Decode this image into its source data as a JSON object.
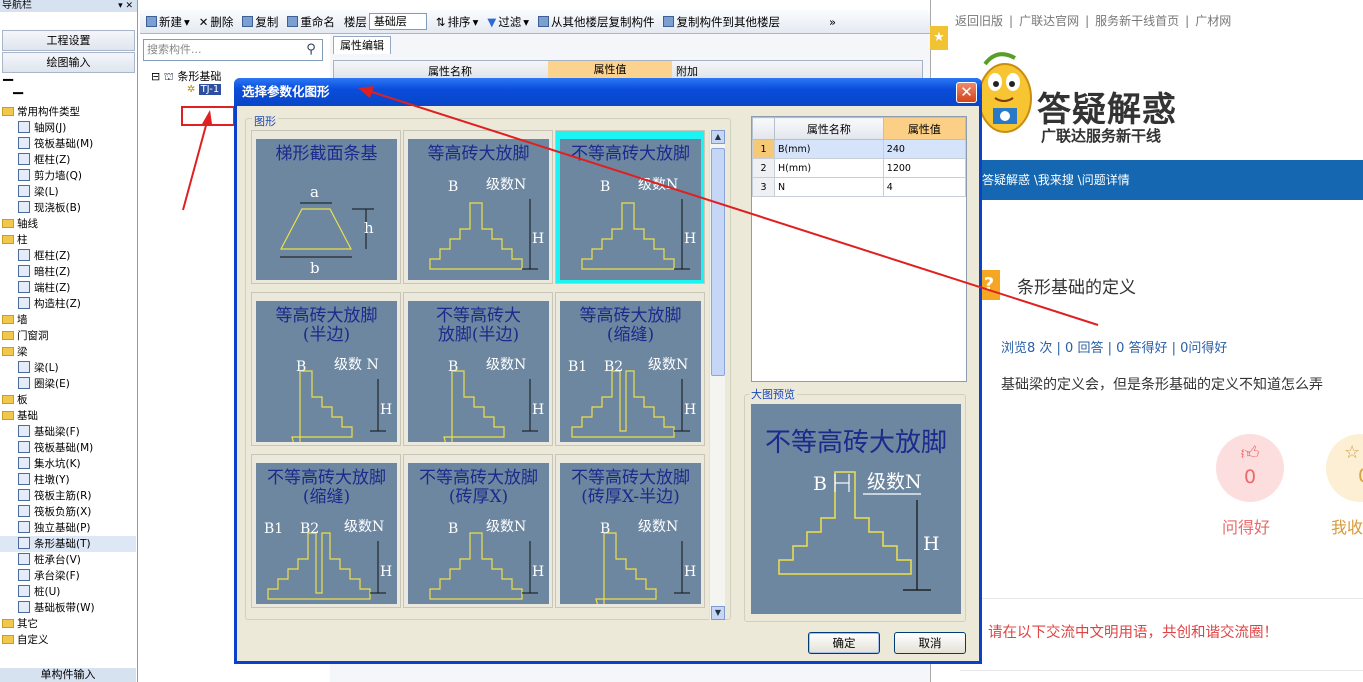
{
  "nav": {
    "title": "导航栏",
    "pin": "▾ ✕",
    "buttons": [
      "工程设置",
      "绘图输入"
    ],
    "tree": [
      {
        "level": 0,
        "type": "folder",
        "label": "常用构件类型"
      },
      {
        "level": 1,
        "label": "轴网(J)"
      },
      {
        "level": 1,
        "label": "筏板基础(M)"
      },
      {
        "level": 1,
        "label": "框柱(Z)"
      },
      {
        "level": 1,
        "label": "剪力墙(Q)"
      },
      {
        "level": 1,
        "label": "梁(L)"
      },
      {
        "level": 1,
        "label": "现浇板(B)"
      },
      {
        "level": 0,
        "type": "folder",
        "label": "轴线"
      },
      {
        "level": 0,
        "type": "folder",
        "label": "柱"
      },
      {
        "level": 1,
        "label": "框柱(Z)"
      },
      {
        "level": 1,
        "label": "暗柱(Z)"
      },
      {
        "level": 1,
        "label": "端柱(Z)"
      },
      {
        "level": 1,
        "label": "构造柱(Z)"
      },
      {
        "level": 0,
        "type": "folder",
        "label": "墙"
      },
      {
        "level": 0,
        "type": "folder",
        "label": "门窗洞"
      },
      {
        "level": 0,
        "type": "folder",
        "label": "梁"
      },
      {
        "level": 1,
        "label": "梁(L)"
      },
      {
        "level": 1,
        "label": "圈梁(E)"
      },
      {
        "level": 0,
        "type": "folder",
        "label": "板"
      },
      {
        "level": 0,
        "type": "folder",
        "label": "基础"
      },
      {
        "level": 1,
        "label": "基础梁(F)"
      },
      {
        "level": 1,
        "label": "筏板基础(M)"
      },
      {
        "level": 1,
        "label": "集水坑(K)"
      },
      {
        "level": 1,
        "label": "柱墩(Y)"
      },
      {
        "level": 1,
        "label": "筏板主筋(R)"
      },
      {
        "level": 1,
        "label": "筏板负筋(X)"
      },
      {
        "level": 1,
        "label": "独立基础(P)"
      },
      {
        "level": 1,
        "label": "条形基础(T)",
        "selected": true
      },
      {
        "level": 1,
        "label": "桩承台(V)"
      },
      {
        "level": 1,
        "label": "承台梁(F)"
      },
      {
        "level": 1,
        "label": "桩(U)"
      },
      {
        "level": 1,
        "label": "基础板带(W)"
      },
      {
        "level": 0,
        "type": "folder",
        "label": "其它"
      },
      {
        "level": 0,
        "type": "folder",
        "label": "自定义"
      }
    ],
    "bottom": "单构件输入"
  },
  "toolbar": {
    "new": "新建",
    "delete": "删除",
    "copy": "复制",
    "rename": "重命名",
    "floor_label": "楼层",
    "floor_value": "基础层",
    "sort": "排序",
    "filter": "过滤",
    "copy_from": "从其他楼层复制构件",
    "copy_to": "复制构件到其他楼层",
    "more": "»"
  },
  "component_panel": {
    "search_placeholder": "搜索构件...",
    "root": "条形基础",
    "child": "TJ-1"
  },
  "property_editor": {
    "tab": "属性编辑",
    "col_name": "属性名称",
    "col_value": "属性值",
    "col_extra": "附加"
  },
  "dialog": {
    "title": "选择参数化图形",
    "group_shapes": "图形",
    "shapes": [
      {
        "caption": "梯形截面条基",
        "kind": "trap"
      },
      {
        "caption": "等高砖大放脚",
        "kind": "step",
        "b": "B",
        "n": "级数N",
        "h": "H"
      },
      {
        "caption": "不等高砖大放脚",
        "kind": "step",
        "b": "B",
        "n": "级数N",
        "h": "H",
        "selected": true
      },
      {
        "caption": "等高砖大放脚\n(半边)",
        "kind": "half",
        "b": "B",
        "n": "级数 N",
        "h": "H"
      },
      {
        "caption": "不等高砖大\n放脚(半边)",
        "kind": "half",
        "b": "B",
        "n": "级数N",
        "h": "H"
      },
      {
        "caption": "等高砖大放脚\n(缩缝)",
        "kind": "gap",
        "b": "B1",
        "b2": "B2",
        "n": "级数N",
        "h": "H"
      },
      {
        "caption": "不等高砖大放脚\n(缩缝)",
        "kind": "gap",
        "b": "B1",
        "b2": "B2",
        "n": "级数N",
        "h": "H"
      },
      {
        "caption": "不等高砖大放脚\n(砖厚X)",
        "kind": "step",
        "b": "B",
        "n": "级数N",
        "h": "H"
      },
      {
        "caption": "不等高砖大放脚\n(砖厚X-半边)",
        "kind": "half",
        "b": "B",
        "n": "级数N",
        "h": "H"
      }
    ],
    "trap_labels": {
      "a": "a",
      "h": "h",
      "b": "b"
    },
    "params": {
      "col_name": "属性名称",
      "col_value": "属性值",
      "rows": [
        {
          "n": "1",
          "name": "B(mm)",
          "value": "240"
        },
        {
          "n": "2",
          "name": "H(mm)",
          "value": "1200"
        },
        {
          "n": "3",
          "name": "N",
          "value": "4"
        }
      ]
    },
    "preview_label": "大图预览",
    "preview": {
      "caption": "不等高砖大放脚",
      "b": "B",
      "n": "级数N",
      "h": "H"
    },
    "ok": "确定",
    "cancel": "取消"
  },
  "web": {
    "topnav": [
      "返回旧版",
      "|",
      "广联达官网",
      "|",
      "服务新干线首页",
      "|",
      "广材网"
    ],
    "title": "答疑解惑",
    "subtitle": "广联达服务新干线",
    "breadcrumb": "答疑解惑 \\我来搜 \\问题详情",
    "question_icon": "?",
    "question_title": "条形基础的定义",
    "stats": "浏览8 次 | 0 回答 | 0 答得好 | 0问得好",
    "body": "基础梁的定义会，但是条形基础的定义不知道怎么弄",
    "good_count": "0",
    "good_label": "问得好",
    "fav_count": "0",
    "fav_label": "我收",
    "note": "请在以下交流中文明用语，共创和谐交流圈！"
  },
  "colors": {
    "dialog_title": "#0a4ddb",
    "thumb_bg": "#6d87a1",
    "annotation": "#e02020",
    "web_bar": "#1467b0"
  }
}
